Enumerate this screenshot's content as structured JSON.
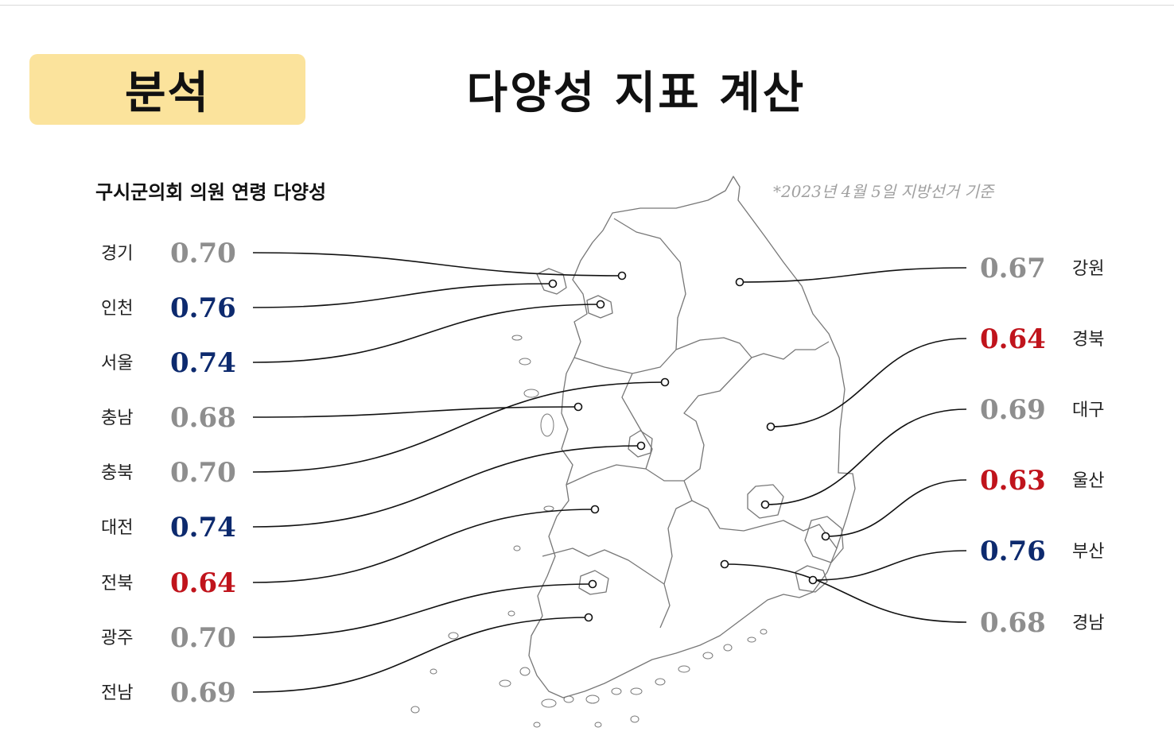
{
  "header": {
    "section_label": "분석",
    "title": "다양성 지표 계산"
  },
  "chart_data": {
    "type": "map",
    "title": "구시군의회 의원 연령 다양성",
    "note": "*2023년 4월 5일 지방선거 기준",
    "colors": {
      "high": "#0d2a6e",
      "mid": "#8e8e8e",
      "low": "#c0141c"
    },
    "regions": [
      {
        "name": "경기",
        "value": 0.7,
        "label": "0.70",
        "level": "mid",
        "side": "left"
      },
      {
        "name": "인천",
        "value": 0.76,
        "label": "0.76",
        "level": "high",
        "side": "left"
      },
      {
        "name": "서울",
        "value": 0.74,
        "label": "0.74",
        "level": "high",
        "side": "left"
      },
      {
        "name": "충남",
        "value": 0.68,
        "label": "0.68",
        "level": "mid",
        "side": "left"
      },
      {
        "name": "충북",
        "value": 0.7,
        "label": "0.70",
        "level": "mid",
        "side": "left"
      },
      {
        "name": "대전",
        "value": 0.74,
        "label": "0.74",
        "level": "high",
        "side": "left"
      },
      {
        "name": "전북",
        "value": 0.64,
        "label": "0.64",
        "level": "low",
        "side": "left"
      },
      {
        "name": "광주",
        "value": 0.7,
        "label": "0.70",
        "level": "mid",
        "side": "left"
      },
      {
        "name": "전남",
        "value": 0.69,
        "label": "0.69",
        "level": "mid",
        "side": "left"
      },
      {
        "name": "강원",
        "value": 0.67,
        "label": "0.67",
        "level": "mid",
        "side": "right"
      },
      {
        "name": "경북",
        "value": 0.64,
        "label": "0.64",
        "level": "low",
        "side": "right"
      },
      {
        "name": "대구",
        "value": 0.69,
        "label": "0.69",
        "level": "mid",
        "side": "right"
      },
      {
        "name": "울산",
        "value": 0.63,
        "label": "0.63",
        "level": "low",
        "side": "right"
      },
      {
        "name": "부산",
        "value": 0.76,
        "label": "0.76",
        "level": "high",
        "side": "right"
      },
      {
        "name": "경남",
        "value": 0.68,
        "label": "0.68",
        "level": "mid",
        "side": "right"
      }
    ]
  }
}
